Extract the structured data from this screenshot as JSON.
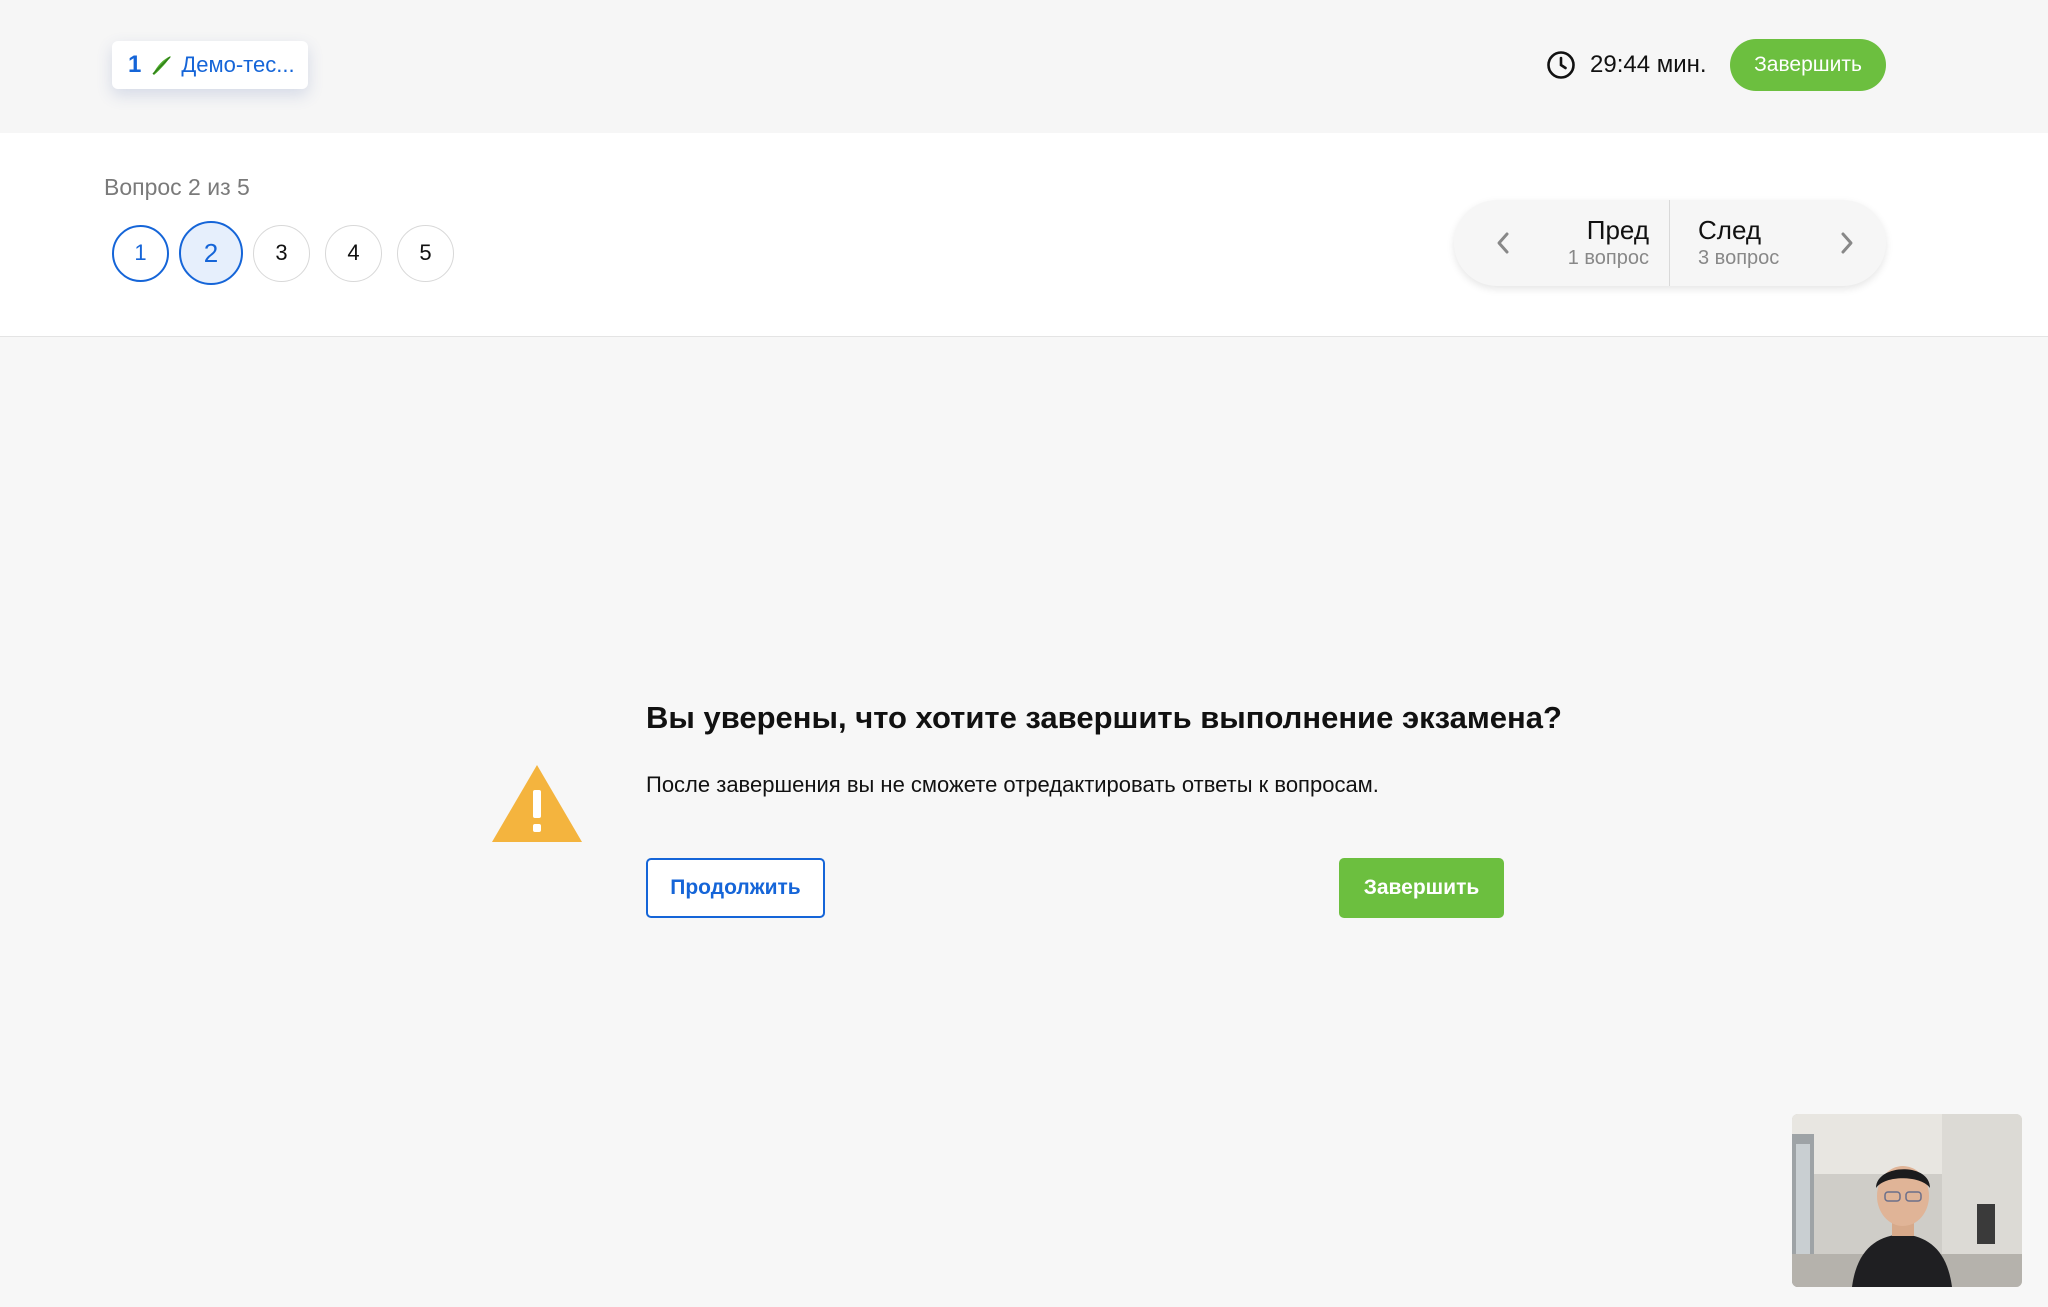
{
  "topbar": {
    "exam_number": "1",
    "exam_title": "Демо-тес...",
    "timer_value": "29:44 мин.",
    "finish_label": "Завершить"
  },
  "question_nav": {
    "counter": "Вопрос 2 из 5",
    "questions": [
      {
        "label": "1",
        "state": "done"
      },
      {
        "label": "2",
        "state": "active"
      },
      {
        "label": "3",
        "state": "default"
      },
      {
        "label": "4",
        "state": "default"
      },
      {
        "label": "5",
        "state": "default"
      }
    ],
    "prev": {
      "label": "Пред",
      "sub": "1 вопрос"
    },
    "next": {
      "label": "След",
      "sub": "3 вопрос"
    }
  },
  "confirm": {
    "title": "Вы уверены, что хотите завершить выполнение экзамена?",
    "text": "После завершения вы не сможете отредактировать ответы к вопросам.",
    "continue_label": "Продолжить",
    "finish_label": "Завершить"
  },
  "colors": {
    "accent_blue": "#1565d8",
    "accent_green": "#6cbf3f",
    "warning": "#f4b43e"
  },
  "icons": {
    "timer": "clock-icon",
    "exam": "leaf-icon",
    "warning": "warning-triangle-icon",
    "prev": "chevron-left-icon",
    "next": "chevron-right-icon"
  }
}
